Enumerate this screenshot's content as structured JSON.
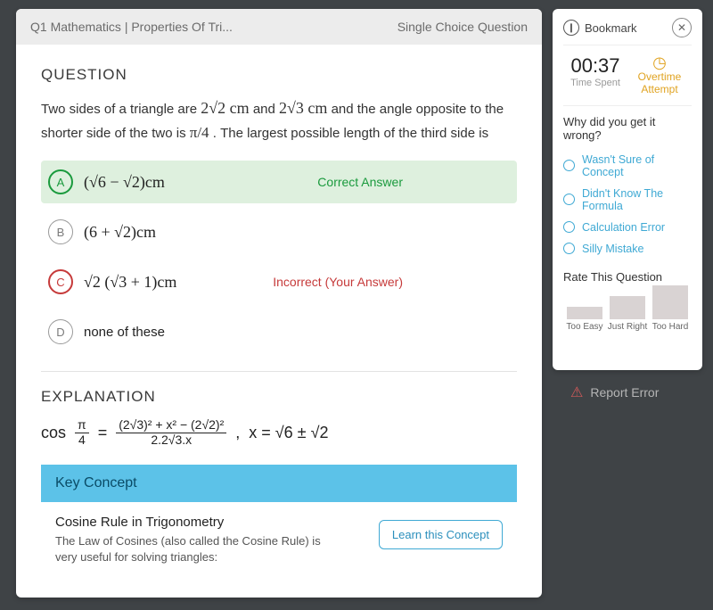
{
  "header": {
    "left": "Q1 Mathematics | Properties Of Tri...",
    "right": "Single Choice Question"
  },
  "question": {
    "title": "QUESTION",
    "text_pre": "Two sides of a triangle are ",
    "side1": "2√2 cm",
    "mid1": " and ",
    "side2": "2√3 cm",
    "mid2": " and the angle opposite to the shorter side of the two is ",
    "angle": "π/4",
    "post": " . The largest possible length of the third side is"
  },
  "options": {
    "a": {
      "letter": "A",
      "text": "(√6 − √2)cm",
      "status": "Correct Answer"
    },
    "b": {
      "letter": "B",
      "text": "(6 + √2)cm"
    },
    "c": {
      "letter": "C",
      "text": "√2 (√3 + 1)cm",
      "status": "Incorrect (Your Answer)"
    },
    "d": {
      "letter": "D",
      "text": "none of these"
    }
  },
  "explanation": {
    "title": "EXPLANATION",
    "lhs": "cos",
    "frac_top": "π",
    "frac_bot": "4",
    "eq": "=",
    "rhs_top": "(2√3)² + x² − (2√2)²",
    "rhs_bot": "2.2√3.x",
    "comma": ",",
    "solve": "x = √6 ± √2"
  },
  "concept": {
    "key": "Key Concept",
    "name": "Cosine Rule in Trigonometry",
    "desc": "The Law of Cosines (also called the Cosine Rule) is very useful for solving triangles:",
    "btn": "Learn this Concept"
  },
  "side": {
    "bookmark": "Bookmark",
    "time": "00:37",
    "time_label": "Time Spent",
    "overtime": "Overtime Attempt",
    "why": "Why did you get it wrong?",
    "reasons": [
      "Wasn't Sure of Concept",
      "Didn't Know The Formula",
      "Calculation Error",
      "Silly Mistake"
    ],
    "rate": "Rate This Question",
    "bar_labels": [
      "Too Easy",
      "Just Right",
      "Too Hard"
    ]
  },
  "report": "Report Error",
  "chart_data": {
    "type": "bar",
    "categories": [
      "Too Easy",
      "Just Right",
      "Too Hard"
    ],
    "values": [
      14,
      26,
      38
    ],
    "title": "Rate This Question",
    "xlabel": "",
    "ylabel": "",
    "ylim": [
      0,
      40
    ]
  }
}
